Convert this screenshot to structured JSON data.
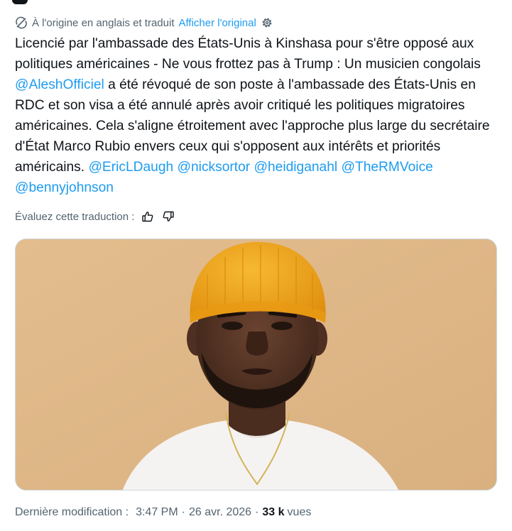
{
  "translation_bar": {
    "origin_text": "À l'origine en anglais et traduit",
    "show_original_label": "Afficher l'original"
  },
  "tweet": {
    "segments": [
      "Licencié par l'ambassade des États-Unis à Kinshasa pour s'être opposé aux politiques américaines - Ne vous frottez pas à Trump : Un musicien congolais ",
      "@AleshOfficiel",
      " a été révoqué de son poste à l'ambassade des États-Unis en RDC et son visa a été annulé après avoir critiqué les politiques migratoires américaines. Cela s'aligne étroitement avec l'approche plus large du secrétaire d'État Marco Rubio envers ceux qui s'opposent aux intérêts et priorités américains. ",
      "@EricLDaugh",
      " ",
      "@nicksortor",
      " ",
      "@heidiganahl",
      " ",
      "@TheRMVoice",
      " ",
      "@bennyjohnson"
    ]
  },
  "rating": {
    "label": "Évaluez cette traduction :"
  },
  "meta": {
    "modified_prefix": "Dernière modification :",
    "time": "3:47 PM",
    "separator": "·",
    "date": "26 avr. 2026",
    "views_count": "33 k",
    "views_label": "vues"
  },
  "colors": {
    "link": "#1d9bf0",
    "secondary_text": "#536471",
    "primary_text": "#0f1419",
    "image_background": "#dfb888",
    "beanie": "#f2a51c"
  },
  "icons": {
    "translate": "translate-icon",
    "settings": "gear-icon",
    "thumbs_up": "thumbs-up-icon",
    "thumbs_down": "thumbs-down-icon"
  }
}
